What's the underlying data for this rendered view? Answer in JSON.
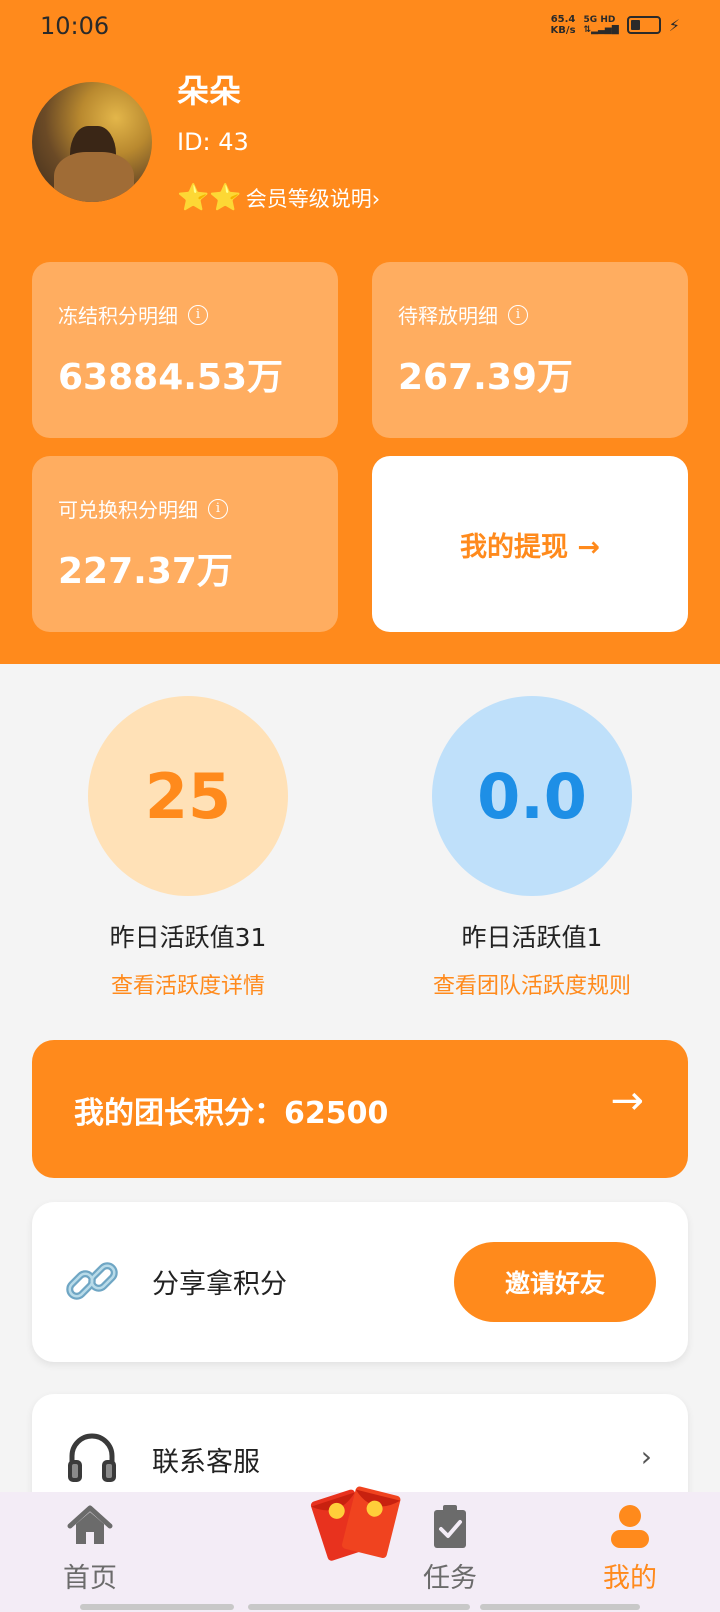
{
  "status_bar": {
    "time": "10:06",
    "net_speed": "65.4",
    "net_unit": "KB/s",
    "signal_tag": "5G HD",
    "signal_sub": "⇅▂▃▅▇"
  },
  "profile": {
    "username": "朵朵",
    "id_text": "ID: 43",
    "stars": "⭐⭐",
    "level_link": "会员等级说明›"
  },
  "cards": [
    {
      "label": "冻结积分明细",
      "value": "63884.53万"
    },
    {
      "label": "待释放明细",
      "value": "267.39万"
    },
    {
      "label": "可兑换积分明细",
      "value": "227.37万"
    }
  ],
  "info_glyph": "i",
  "withdraw_label": "我的提现 →",
  "activity": [
    {
      "value": "25",
      "title": "昨日活跃值31",
      "link": "查看活跃度详情"
    },
    {
      "value": "0.0",
      "title": "昨日活跃值1",
      "link": "查看团队活跃度规则"
    }
  ],
  "leader": {
    "text": "我的团长积分：62500",
    "arrow": "→"
  },
  "share": {
    "text": "分享拿积分",
    "button": "邀请好友",
    "icon": "link-icon"
  },
  "service": {
    "text": "联系客服",
    "chevron": "›",
    "icon": "headset-icon"
  },
  "tabs": [
    {
      "label": "首页",
      "icon": "home-icon",
      "active": false
    },
    {
      "label": "任务",
      "icon": "clipboard-check-icon",
      "active": false
    },
    {
      "label": "我的",
      "icon": "person-icon",
      "active": true
    }
  ],
  "colors": {
    "accent": "#ff8a1c",
    "blue": "#1e8fe6",
    "tabbar_bg": "#f3ecf6"
  }
}
